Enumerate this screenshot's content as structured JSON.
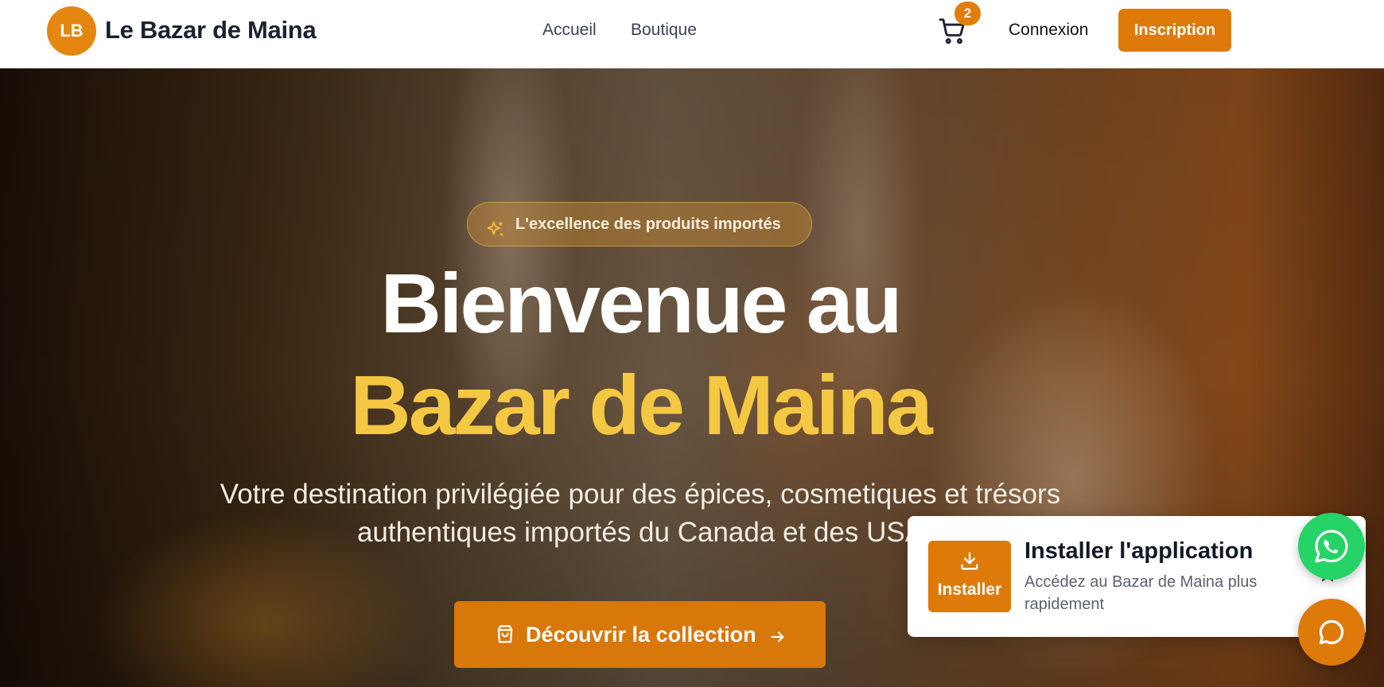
{
  "brand": {
    "logo_initials": "LB",
    "name": "Le Bazar de Maina",
    "accent_color": "#DD7A0A"
  },
  "nav": {
    "items": [
      {
        "label": "Accueil"
      },
      {
        "label": "Boutique"
      }
    ]
  },
  "header_actions": {
    "cart_icon": "shopping-cart-icon",
    "cart_count": "2",
    "login_label": "Connexion",
    "signup_label": "Inscription"
  },
  "hero": {
    "badge_icon": "sparkles-icon",
    "badge_text": "L'excellence des produits importés",
    "title_line1": "Bienvenue au",
    "title_line2": "Bazar de Maina",
    "subtitle": "Votre destination privilégiée pour des épices, cosmetiques et trésors authentiques importés du Canada et des USA",
    "cta_label": "Découvrir la collection",
    "cta_icon": "shopping-bag-icon",
    "cta_arrow_icon": "arrow-right-icon",
    "highlight_color": "#F4C842"
  },
  "install_prompt": {
    "button_icon": "download-icon",
    "button_label": "Installer",
    "title": "Installer l'application",
    "description": "Accédez au Bazar de Maina plus rapidement",
    "close_icon": "close-icon"
  },
  "floating": {
    "whatsapp_icon": "whatsapp-icon",
    "whatsapp_color": "#25D366",
    "chat_icon": "chat-bubble-icon"
  }
}
